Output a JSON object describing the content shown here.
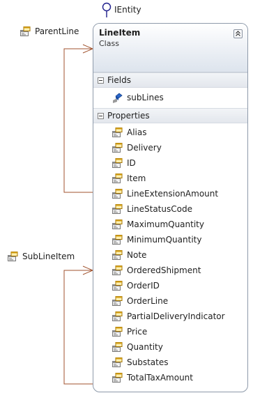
{
  "interface": {
    "name": "IEntity"
  },
  "associations": {
    "parent": {
      "label": "ParentLine"
    },
    "sub": {
      "label": "SubLineItem"
    }
  },
  "class": {
    "name": "LineItem",
    "stereotype": "Class",
    "sections": {
      "fields": {
        "title": "Fields",
        "items": [
          "subLines"
        ]
      },
      "properties": {
        "title": "Properties",
        "items": [
          "Alias",
          "Delivery",
          "ID",
          "Item",
          "LineExtensionAmount",
          "LineStatusCode",
          "MaximumQuantity",
          "MinimumQuantity",
          "Note",
          "OrderedShipment",
          "OrderID",
          "OrderLine",
          "PartialDeliveryIndicator",
          "Price",
          "Quantity",
          "Substates",
          "TotalTaxAmount"
        ]
      }
    }
  },
  "colors": {
    "connector": "#a0522d",
    "border": "#8e9aaa",
    "header_bottom": "#dde4ed",
    "lollipop": "#1e1e8c"
  },
  "icons": {
    "property": "property-icon",
    "field": "field-icon",
    "interface": "lollipop-icon",
    "collapse": "double-chevron-up-icon"
  }
}
